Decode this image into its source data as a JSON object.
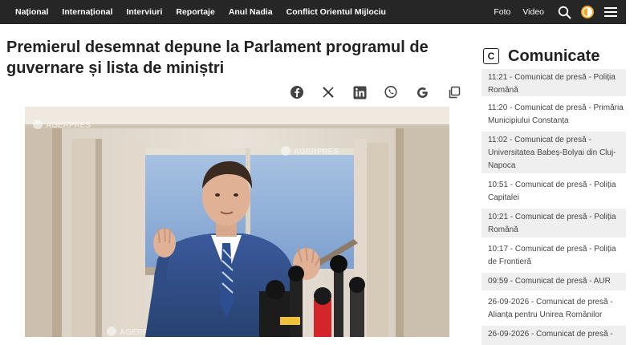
{
  "nav": {
    "items": [
      "Național",
      "Internațional",
      "Interviuri",
      "Reportaje",
      "Anul Nadia",
      "Conflict Orientul Mijlociu"
    ],
    "right": {
      "foto": "Foto",
      "video": "Video"
    },
    "icons": [
      "search-icon",
      "theme-toggle-icon",
      "menu-icon"
    ]
  },
  "article": {
    "headline": "Premierul desemnat depune la Parlament programul de guvernare și lista de miniștri",
    "share": [
      "facebook-icon",
      "x-icon",
      "linkedin-icon",
      "whatsapp-icon",
      "google-icon",
      "copy-icon"
    ],
    "photo_watermark": "AGERPRES"
  },
  "sidebar": {
    "badge": "C",
    "title": "Comunicate",
    "items": [
      "11:21 - Comunicat de presă - Poliția Română",
      "11:20 - Comunicat de presă - Primăria Municipiului Constanța",
      "11:02 - Comunicat de presă - Universitatea Babeș-Bolyai din Cluj-Napoca",
      "10:51 - Comunicat de presă - Poliția Capitalei",
      "10:21 - Comunicat de presă - Poliția Română",
      "10:17 - Comunicat de presă - Poliția de Frontieră",
      "09:59 - Comunicat de presă - AUR",
      "26-09-2026 - Comunicat de presă - Alianța pentru Unirea Românilor",
      "26-09-2026 - Comunicat de presă -"
    ]
  },
  "colors": {
    "nav_bg": "#262626",
    "accent_orange": "#f5a623",
    "sidebar_shade": "#efefef"
  }
}
